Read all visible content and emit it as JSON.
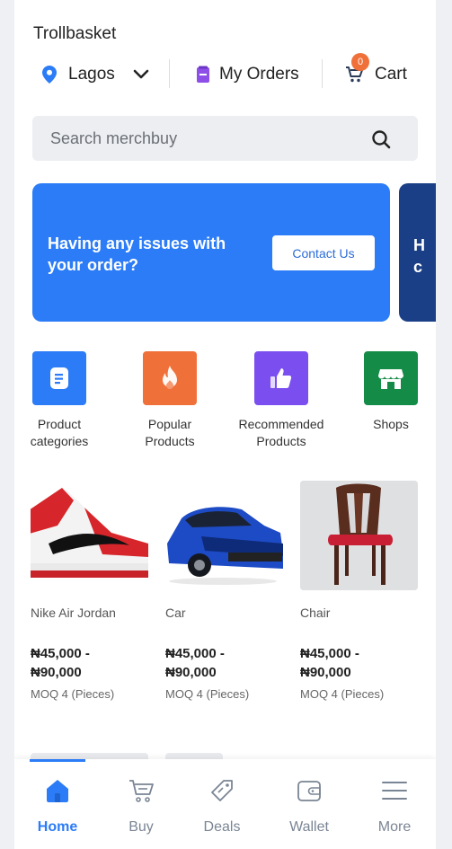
{
  "store": {
    "name": "Trollbasket"
  },
  "topbar": {
    "location": "Lagos",
    "orders_label": "My Orders",
    "cart_label": "Cart",
    "cart_count": "0"
  },
  "search": {
    "placeholder": "Search merchbuy"
  },
  "banner": {
    "message": "Having any issues with your order?",
    "cta_label": "Contact Us",
    "next_peek": "H\nc"
  },
  "categories": [
    {
      "label": "Product categories",
      "icon": "document-icon",
      "color": "#2b7cf6"
    },
    {
      "label": "Popular Products",
      "icon": "flame-icon",
      "color": "#f0703a"
    },
    {
      "label": "Recommended Products",
      "icon": "thumbs-up-icon",
      "color": "#7b4ef0"
    },
    {
      "label": "Shops",
      "icon": "store-icon",
      "color": "#148b46"
    }
  ],
  "products": [
    {
      "name": "Nike Air Jordan",
      "price": "₦45,000 - ₦90,000",
      "price_lines": [
        "₦45,000 -",
        "₦90,000"
      ],
      "moq": "MOQ 4 (Pieces)"
    },
    {
      "name": "Car",
      "price": "₦45,000 - ₦90,000",
      "price_lines": [
        "₦45,000 -",
        "₦90,000"
      ],
      "moq": "MOQ 4 (Pieces)"
    },
    {
      "name": "Chair",
      "price": "₦45,000 - ₦90,000",
      "price_lines": [
        "₦45,000 -",
        "₦90,000"
      ],
      "moq": "MOQ 4 (Pieces)"
    }
  ],
  "nav": {
    "items": [
      {
        "label": "Home",
        "icon": "home-icon",
        "active": true
      },
      {
        "label": "Buy",
        "icon": "cart-icon",
        "active": false
      },
      {
        "label": "Deals",
        "icon": "tag-icon",
        "active": false
      },
      {
        "label": "Wallet",
        "icon": "wallet-icon",
        "active": false
      },
      {
        "label": "More",
        "icon": "menu-icon",
        "active": false
      }
    ]
  },
  "colors": {
    "accent": "#2b7cf6",
    "badge": "#f0703a"
  }
}
